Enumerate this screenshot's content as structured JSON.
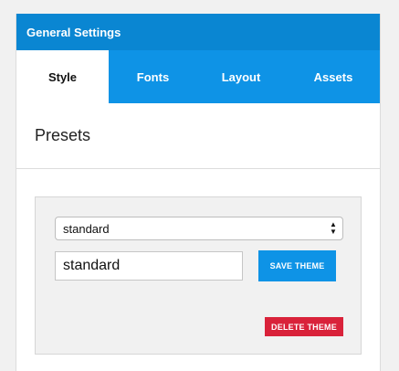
{
  "header": {
    "title": "General Settings"
  },
  "tabs": [
    {
      "label": "Style",
      "active": true
    },
    {
      "label": "Fonts",
      "active": false
    },
    {
      "label": "Layout",
      "active": false
    },
    {
      "label": "Assets",
      "active": false
    }
  ],
  "presets": {
    "title": "Presets",
    "select_value": "standard",
    "name_input_value": "standard",
    "save_label": "SAVE THEME",
    "delete_label": "DELETE THEME"
  },
  "colors": {
    "header_bg": "#0a86d2",
    "tab_bg": "#0e93e6",
    "delete_bg": "#d9223a"
  }
}
